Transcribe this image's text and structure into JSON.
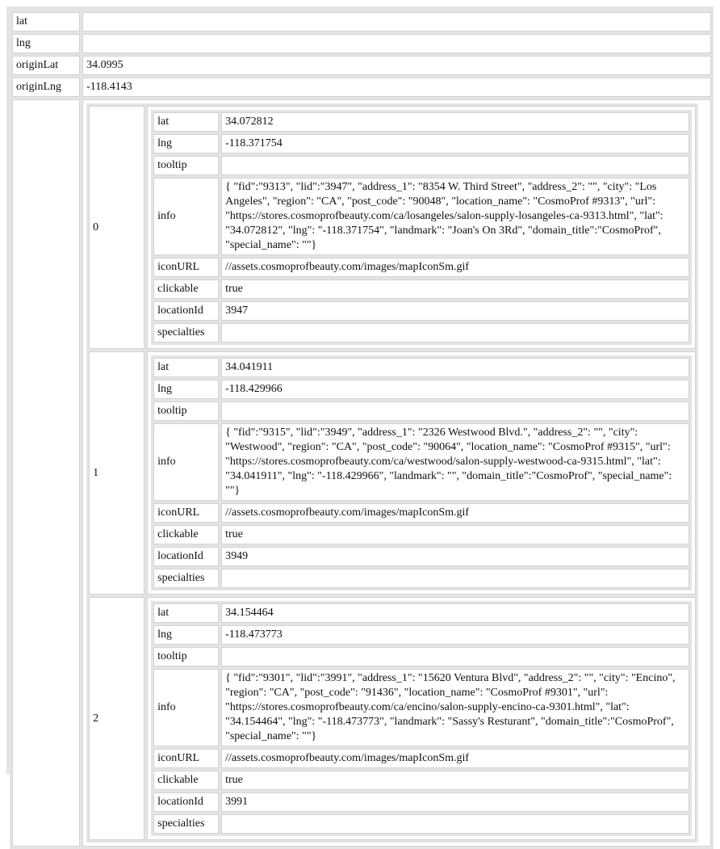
{
  "root": {
    "lat_key": "lat",
    "lat_val": "",
    "lng_key": "lng",
    "lng_val": "",
    "originLat_key": "originLat",
    "originLat_val": "34.0995",
    "originLng_key": "originLng",
    "originLng_val": "-118.4143"
  },
  "keys": {
    "lat": "lat",
    "lng": "lng",
    "tooltip": "tooltip",
    "info": "info",
    "iconURL": "iconURL",
    "clickable": "clickable",
    "locationId": "locationId",
    "specialties": "specialties"
  },
  "items": [
    {
      "index": "0",
      "lat": "34.072812",
      "lng": "-118.371754",
      "tooltip": "",
      "info": "{ \"fid\":\"9313\", \"lid\":\"3947\", \"address_1\": \"8354 W. Third Street\", \"address_2\": \"\", \"city\": \"Los Angeles\", \"region\": \"CA\", \"post_code\": \"90048\", \"location_name\": \"CosmoProf #9313\", \"url\": \"https://stores.cosmoprofbeauty.com/ca/losangeles/salon-supply-losangeles-ca-9313.html\", \"lat\": \"34.072812\", \"lng\": \"-118.371754\", \"landmark\": \"Joan's On 3Rd\", \"domain_title\":\"CosmoProf\", \"special_name\": \"\"}",
      "iconURL": "//assets.cosmoprofbeauty.com/images/mapIconSm.gif",
      "clickable": "true",
      "locationId": "3947",
      "specialties": ""
    },
    {
      "index": "1",
      "lat": "34.041911",
      "lng": "-118.429966",
      "tooltip": "",
      "info": "{ \"fid\":\"9315\", \"lid\":\"3949\", \"address_1\": \"2326 Westwood Blvd.\", \"address_2\": \"\", \"city\": \"Westwood\", \"region\": \"CA\", \"post_code\": \"90064\", \"location_name\": \"CosmoProf #9315\", \"url\": \"https://stores.cosmoprofbeauty.com/ca/westwood/salon-supply-westwood-ca-9315.html\", \"lat\": \"34.041911\", \"lng\": \"-118.429966\", \"landmark\": \"\", \"domain_title\":\"CosmoProf\", \"special_name\": \"\"}",
      "iconURL": "//assets.cosmoprofbeauty.com/images/mapIconSm.gif",
      "clickable": "true",
      "locationId": "3949",
      "specialties": ""
    },
    {
      "index": "2",
      "lat": "34.154464",
      "lng": "-118.473773",
      "tooltip": "",
      "info": "{ \"fid\":\"9301\", \"lid\":\"3991\", \"address_1\": \"15620 Ventura Blvd\", \"address_2\": \"\", \"city\": \"Encino\", \"region\": \"CA\", \"post_code\": \"91436\", \"location_name\": \"CosmoProf #9301\", \"url\": \"https://stores.cosmoprofbeauty.com/ca/encino/salon-supply-encino-ca-9301.html\", \"lat\": \"34.154464\", \"lng\": \"-118.473773\", \"landmark\": \"Sassy's Resturant\", \"domain_title\":\"CosmoProf\", \"special_name\": \"\"}",
      "iconURL": "//assets.cosmoprofbeauty.com/images/mapIconSm.gif",
      "clickable": "true",
      "locationId": "3991",
      "specialties": ""
    }
  ]
}
